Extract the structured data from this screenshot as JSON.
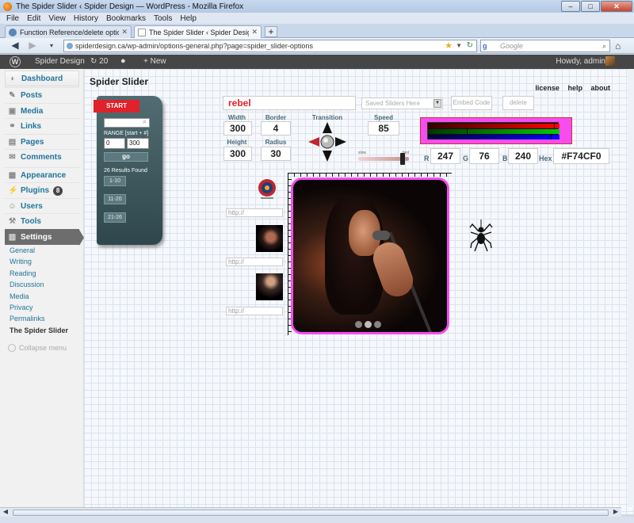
{
  "browser": {
    "window_title": "The Spider Slider ‹ Spider Design — WordPress - Mozilla Firefox",
    "menu": [
      "File",
      "Edit",
      "View",
      "History",
      "Bookmarks",
      "Tools",
      "Help"
    ],
    "tabs": [
      {
        "label": "Function Reference/delete option « ...",
        "active": false
      },
      {
        "label": "The Spider Slider ‹ Spider Design — ...",
        "active": true
      }
    ],
    "url": "spiderdesign.ca/wp-admin/options-general.php?page=spider_slider-options",
    "search_placeholder": "Google",
    "search_engine_glyph": "g"
  },
  "adminbar": {
    "logo": "W",
    "site_name": "Spider Design",
    "updates": "20",
    "new_label": "New",
    "howdy": "Howdy, admin"
  },
  "sidebar": {
    "items": [
      {
        "label": "Dashboard",
        "icon": "dashboard-icon",
        "glyph": "◐"
      },
      {
        "label": "Posts",
        "icon": "pin-icon",
        "glyph": "✎"
      },
      {
        "label": "Media",
        "icon": "media-icon",
        "glyph": "▣"
      },
      {
        "label": "Links",
        "icon": "link-icon",
        "glyph": "⚭"
      },
      {
        "label": "Pages",
        "icon": "page-icon",
        "glyph": "▤"
      },
      {
        "label": "Comments",
        "icon": "comment-icon",
        "glyph": "✉"
      },
      {
        "label": "Appearance",
        "icon": "appearance-icon",
        "glyph": "▦"
      },
      {
        "label": "Plugins",
        "icon": "plugin-icon",
        "glyph": "⚡",
        "badge": "8"
      },
      {
        "label": "Users",
        "icon": "users-icon",
        "glyph": "☺"
      },
      {
        "label": "Tools",
        "icon": "tools-icon",
        "glyph": "⚒"
      },
      {
        "label": "Settings",
        "icon": "settings-icon",
        "glyph": "▥"
      }
    ],
    "submenu": [
      "General",
      "Writing",
      "Reading",
      "Discussion",
      "Media",
      "Privacy",
      "Permalinks",
      "The Spider Slider"
    ],
    "collapse": "Collapse menu"
  },
  "page": {
    "title": "Spider Slider",
    "links": [
      "license",
      "help",
      "about"
    ]
  },
  "panel": {
    "start": "START",
    "range_label": "RANGE [start + #]",
    "range_start": "0",
    "range_count": "300",
    "go": "go",
    "results": "26 Results Found",
    "ranges": [
      "1-10",
      "11-20",
      "21-26"
    ]
  },
  "controls": {
    "slider_name": "rebel",
    "saved_placeholder": "Saved Sliders Here",
    "embed_label": "Embed Code",
    "delete_label": "delete",
    "width_label": "Width",
    "width": "300",
    "border_label": "Border",
    "border": "4",
    "height_label": "Height",
    "height": "300",
    "radius_label": "Radius",
    "radius": "30",
    "transition_label": "Transition",
    "speed_label": "Speed",
    "speed": "85",
    "slider_lo": "slow",
    "slider_hi": "fast",
    "speed_fraction": 0.85
  },
  "color": {
    "r_label": "R",
    "r": "247",
    "g_label": "G",
    "g": "76",
    "b_label": "B",
    "b": "240",
    "hex_label": "Hex",
    "hex": "#F74CF0",
    "frame_color": "#f74cf0"
  },
  "slides": {
    "url_placeholder": "http://",
    "dots": 3
  }
}
